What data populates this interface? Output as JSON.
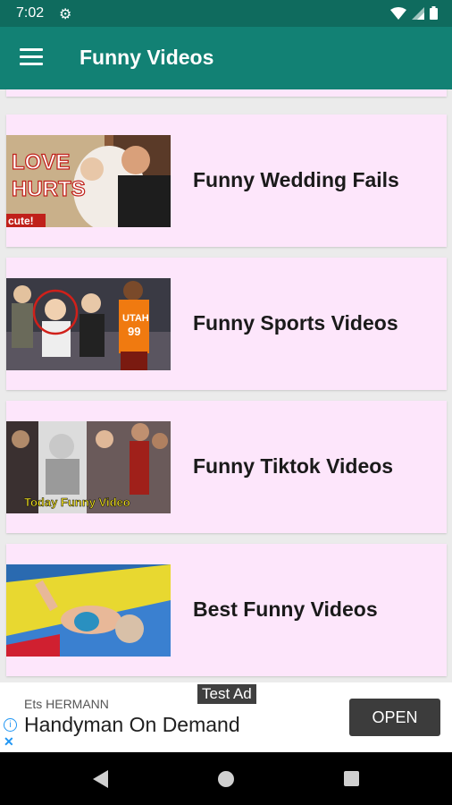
{
  "status_bar": {
    "time": "7:02",
    "icons": [
      "settings-gear-icon",
      "wifi-icon",
      "signal-icon",
      "battery-icon"
    ]
  },
  "app_bar": {
    "menu_icon": "hamburger-menu-icon",
    "title": "Funny Videos",
    "color": "#128174"
  },
  "list": {
    "card_color": "#fde6fb",
    "items": [
      {
        "title": "Funny Wedding Fails",
        "thumbnail": "wedding-couple-image",
        "thumbnail_text": [
          "LOVE",
          "HURTS",
          "cute!"
        ]
      },
      {
        "title": "Funny Sports Videos",
        "thumbnail": "basketball-crowd-image",
        "thumbnail_text": [
          "UTAH",
          "99"
        ]
      },
      {
        "title": "Funny Tiktok Videos",
        "thumbnail": "tiktok-collage-image",
        "thumbnail_text": [
          "Today Funny Video"
        ]
      },
      {
        "title": "Best Funny Videos",
        "thumbnail": "water-slide-child-image",
        "thumbnail_text": []
      }
    ]
  },
  "ad": {
    "label": "Test Ad",
    "advertiser": "Ets HERMANN",
    "headline": "Handyman On Demand",
    "cta": "OPEN",
    "info_icon": "info-icon",
    "close_icon": "close-icon"
  },
  "nav_bar": {
    "icons": [
      "back-icon",
      "home-icon",
      "recents-icon"
    ]
  }
}
